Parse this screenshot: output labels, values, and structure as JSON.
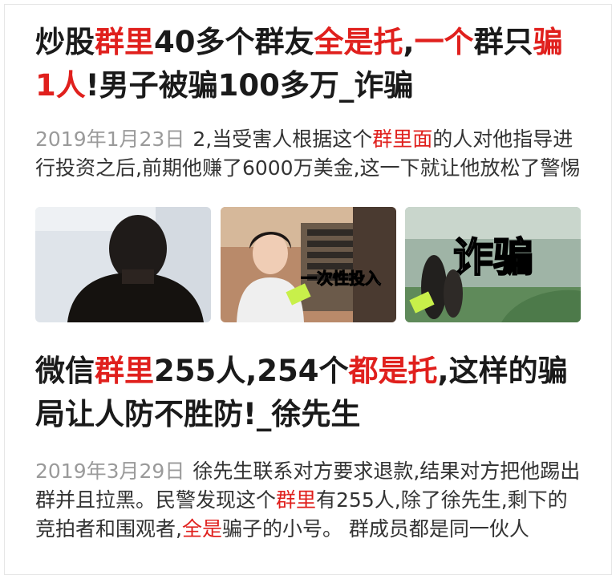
{
  "results": [
    {
      "title_parts": [
        {
          "text": "炒股",
          "hl": false
        },
        {
          "text": "群里",
          "hl": true
        },
        {
          "text": "40多个群友",
          "hl": false
        },
        {
          "text": "全是托",
          "hl": true
        },
        {
          "text": ",",
          "hl": false
        },
        {
          "text": "一个",
          "hl": true
        },
        {
          "text": "群只",
          "hl": false
        },
        {
          "text": "骗1人",
          "hl": true
        },
        {
          "text": "!男子被骗100多万_诈骗",
          "hl": false
        }
      ],
      "date": "2019年1月23日",
      "snippet_parts": [
        {
          "text": "2,当受害人根据这个",
          "hl": false
        },
        {
          "text": "群里面",
          "hl": true
        },
        {
          "text": "的人对他指导进行投资之后,前期他赚了6000万美金,这一下就让他放松了警惕",
          "hl": false
        }
      ],
      "thumbnails": [
        {
          "name": "thumbnail-man-back-view"
        },
        {
          "name": "thumbnail-woman-interview",
          "caption": "一次性投入"
        },
        {
          "name": "thumbnail-scam-title",
          "caption": "诈骗"
        }
      ]
    },
    {
      "title_parts": [
        {
          "text": "微信",
          "hl": false
        },
        {
          "text": "群里",
          "hl": true
        },
        {
          "text": "255人,254个",
          "hl": false
        },
        {
          "text": "都是托",
          "hl": true
        },
        {
          "text": ",这样的骗局让人防不胜防!_徐先生",
          "hl": false
        }
      ],
      "date": "2019年3月29日",
      "snippet_parts": [
        {
          "text": "徐先生联系对方要求退款,结果对方把他踢出群并且拉黑。民警发现这个",
          "hl": false
        },
        {
          "text": "群里",
          "hl": true
        },
        {
          "text": "有255人,除了徐先生,剩下的竞拍者和围观者,",
          "hl": false
        },
        {
          "text": "全是",
          "hl": true
        },
        {
          "text": "骗子的小号。 群成员都是同一伙人",
          "hl": false
        }
      ]
    }
  ],
  "colors": {
    "highlight": "#e0201d",
    "title": "#1a1a1a",
    "snippet": "#333333",
    "date": "#9a9a9a"
  }
}
